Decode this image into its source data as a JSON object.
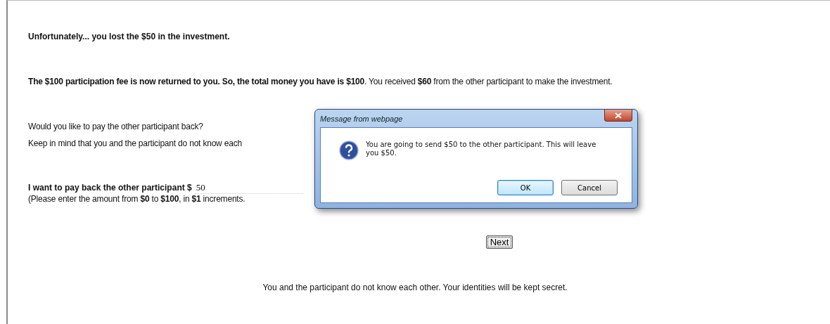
{
  "page": {
    "result": "Unfortunately... you lost the $50 in the investment.",
    "summary": "**The $100 participation fee is now returned to you. So, the total money you have is $100**. You received **$60** from the other participant to make the investment.",
    "question": "Would you like to pay the other participant back?",
    "reminder": "Keep in mind that you and the participant do not know each",
    "amount_label": "I want to pay back the other participant $",
    "amount_value": "50",
    "amount_hint": "(Please enter the amount from **$0** to **$100**, in **$1** increments.",
    "next_button": "Next",
    "footer": "You and the participant do not know each other. Your identities will be kept secret."
  },
  "dialog": {
    "title": "Message from webpage",
    "message": "You are going to send $50 to the other participant. This will leave you $50.",
    "buttons": [
      {
        "label": "OK",
        "selected": true
      },
      {
        "label": "Cancel",
        "selected": false
      }
    ]
  }
}
